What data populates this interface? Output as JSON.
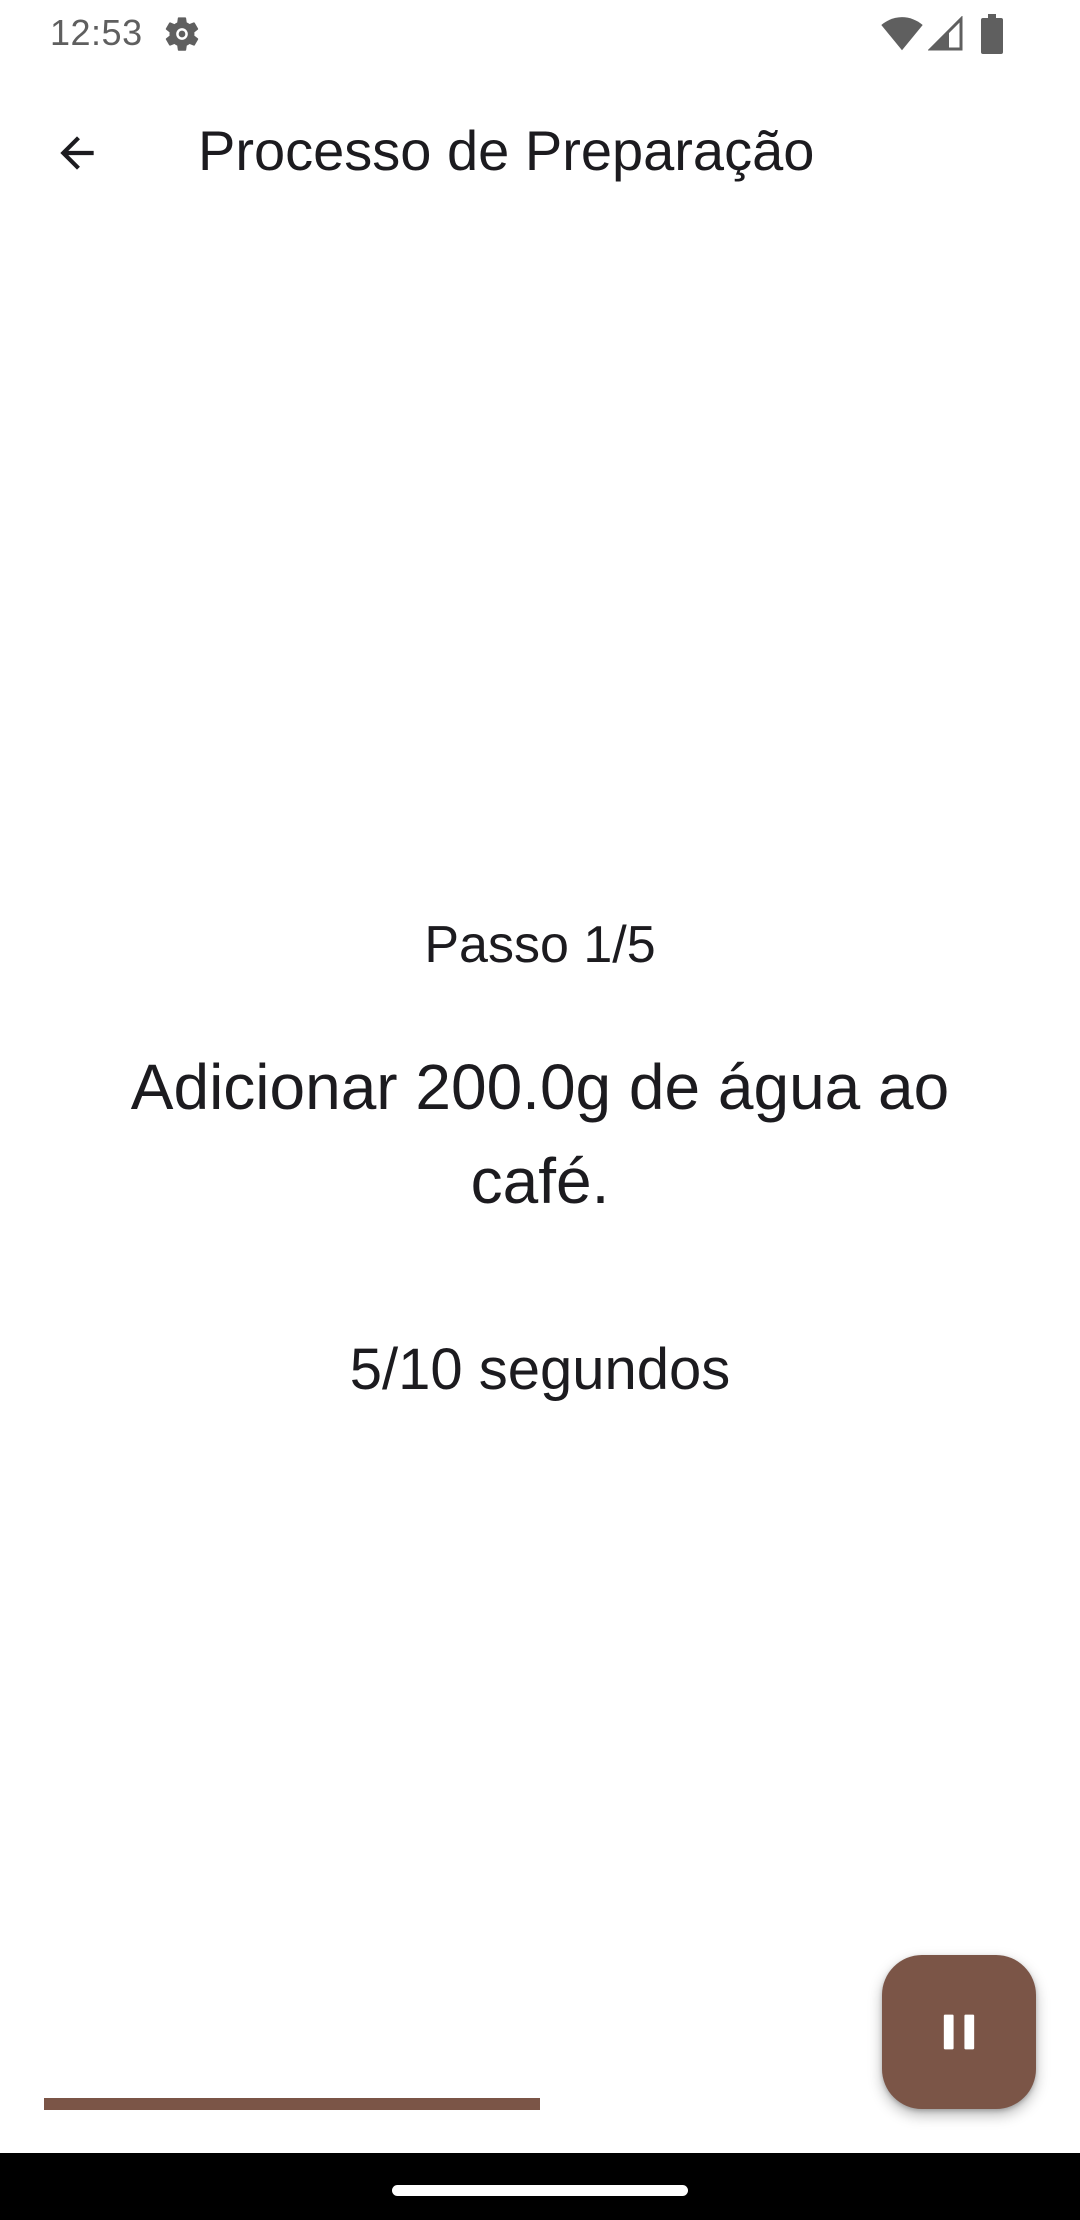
{
  "status_bar": {
    "time": "12:53",
    "icons": [
      "settings-icon",
      "wifi-icon",
      "signal-icon",
      "battery-icon"
    ]
  },
  "app_bar": {
    "title": "Processo de Preparação",
    "back_icon": "arrow-back-icon"
  },
  "step": {
    "label": "Passo 1/5",
    "instruction": "Adicionar 200.0g de água ao café.",
    "timer": "5/10 segundos",
    "progress_fraction": 0.5
  },
  "fab": {
    "icon": "pause-icon"
  },
  "colors": {
    "accent": "#7b5547",
    "text": "#1c1b1f",
    "status_text": "#5f5f5f",
    "background": "#ffffff",
    "nav_bar": "#000000"
  }
}
